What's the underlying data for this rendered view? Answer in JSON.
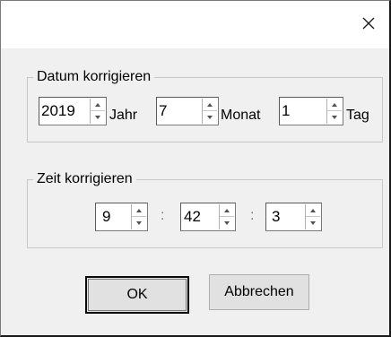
{
  "window": {
    "close_icon": "close-icon"
  },
  "datum": {
    "title": "Datum korrigieren",
    "year": {
      "value": "2019",
      "unit": "Jahr"
    },
    "month": {
      "value": "7",
      "unit": "Monat"
    },
    "day": {
      "value": "1",
      "unit": "Tag"
    }
  },
  "zeit": {
    "title": "Zeit korrigieren",
    "hour": {
      "value": "9"
    },
    "minute": {
      "value": "42"
    },
    "second": {
      "value": "3"
    },
    "separator": ":"
  },
  "buttons": {
    "ok": "OK",
    "cancel": "Abbrechen"
  },
  "icons": {
    "spin_up": "triangle-up-icon",
    "spin_down": "triangle-down-icon"
  },
  "colors": {
    "dialog_bg": "#f0f0f0",
    "titlebar_bg": "#ffffff",
    "button_bg": "#e1e1e1",
    "group_border": "#c8c8c8"
  }
}
